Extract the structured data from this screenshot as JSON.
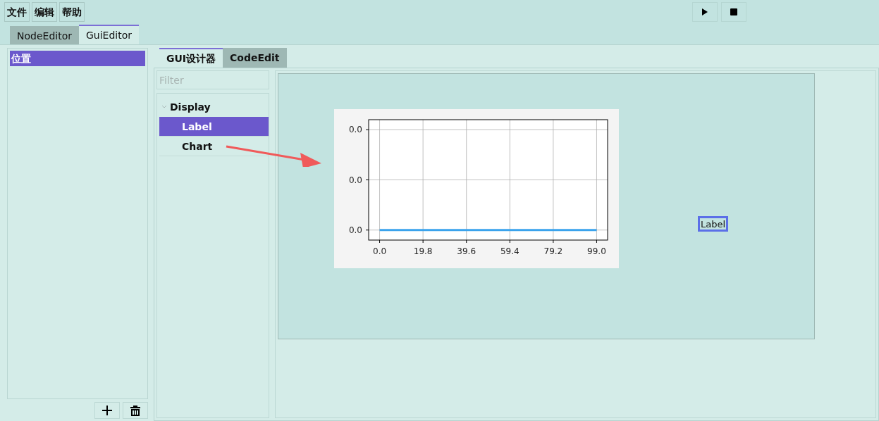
{
  "menu": [
    "文件",
    "编辑",
    "帮助"
  ],
  "toolbar": [
    {
      "kind": "play"
    },
    {
      "kind": "stop"
    }
  ],
  "tabs": [
    {
      "label": "NodeEditor",
      "selected": false
    },
    {
      "label": "GuiEditor",
      "selected": true
    }
  ],
  "left_list": {
    "items": [
      {
        "label": "位置",
        "selected": true
      }
    ],
    "buttons": [
      {
        "kind": "add"
      },
      {
        "kind": "delete"
      }
    ]
  },
  "inner_tabs": [
    {
      "label": "GUI设计器",
      "selected": true
    },
    {
      "label": "CodeEdit",
      "selected": false
    }
  ],
  "filter": {
    "placeholder": "Filter"
  },
  "tree": [
    {
      "label": "Display",
      "expanded": true,
      "children": [
        {
          "label": "Label",
          "selected": true
        },
        {
          "label": "Chart",
          "selected": false
        }
      ]
    }
  ],
  "canvas": {
    "widgets": [
      {
        "kind": "chart",
        "chart_data": {
          "type": "line",
          "grid": true,
          "x": [
            0,
            99
          ],
          "series": [
            {
              "color": "#3ba3ec",
              "values": [
                0,
                0
              ]
            }
          ],
          "xlim": [
            -5,
            104
          ],
          "ylim": [
            -0.004,
            0.044
          ],
          "xticks": [
            {
              "value": 0,
              "label": "0.0"
            },
            {
              "value": 19.8,
              "label": "19.8"
            },
            {
              "value": 39.6,
              "label": "39.6"
            },
            {
              "value": 59.4,
              "label": "59.4"
            },
            {
              "value": 79.2,
              "label": "79.2"
            },
            {
              "value": 99,
              "label": "99.0"
            }
          ],
          "yticks": [
            {
              "value": 0,
              "label": "0.0"
            },
            {
              "value": 0.02,
              "label": "0.0"
            },
            {
              "value": 0.04,
              "label": "0.0"
            }
          ]
        }
      },
      {
        "kind": "label",
        "text": "Label",
        "selected": true
      }
    ]
  }
}
